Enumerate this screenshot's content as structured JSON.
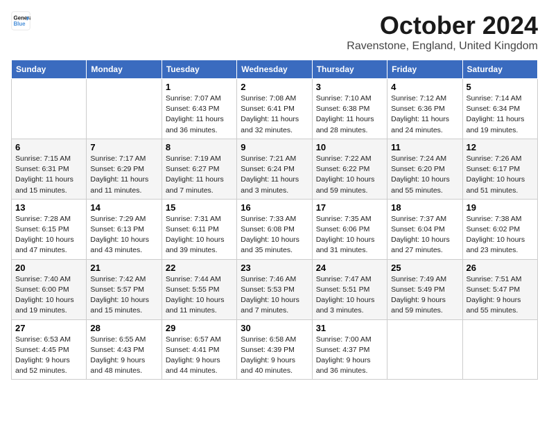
{
  "header": {
    "logo_line1": "General",
    "logo_line2": "Blue",
    "month_title": "October 2024",
    "location": "Ravenstone, England, United Kingdom"
  },
  "weekdays": [
    "Sunday",
    "Monday",
    "Tuesday",
    "Wednesday",
    "Thursday",
    "Friday",
    "Saturday"
  ],
  "weeks": [
    [
      {
        "day": "",
        "text": ""
      },
      {
        "day": "",
        "text": ""
      },
      {
        "day": "1",
        "text": "Sunrise: 7:07 AM\nSunset: 6:43 PM\nDaylight: 11 hours\nand 36 minutes."
      },
      {
        "day": "2",
        "text": "Sunrise: 7:08 AM\nSunset: 6:41 PM\nDaylight: 11 hours\nand 32 minutes."
      },
      {
        "day": "3",
        "text": "Sunrise: 7:10 AM\nSunset: 6:38 PM\nDaylight: 11 hours\nand 28 minutes."
      },
      {
        "day": "4",
        "text": "Sunrise: 7:12 AM\nSunset: 6:36 PM\nDaylight: 11 hours\nand 24 minutes."
      },
      {
        "day": "5",
        "text": "Sunrise: 7:14 AM\nSunset: 6:34 PM\nDaylight: 11 hours\nand 19 minutes."
      }
    ],
    [
      {
        "day": "6",
        "text": "Sunrise: 7:15 AM\nSunset: 6:31 PM\nDaylight: 11 hours\nand 15 minutes."
      },
      {
        "day": "7",
        "text": "Sunrise: 7:17 AM\nSunset: 6:29 PM\nDaylight: 11 hours\nand 11 minutes."
      },
      {
        "day": "8",
        "text": "Sunrise: 7:19 AM\nSunset: 6:27 PM\nDaylight: 11 hours\nand 7 minutes."
      },
      {
        "day": "9",
        "text": "Sunrise: 7:21 AM\nSunset: 6:24 PM\nDaylight: 11 hours\nand 3 minutes."
      },
      {
        "day": "10",
        "text": "Sunrise: 7:22 AM\nSunset: 6:22 PM\nDaylight: 10 hours\nand 59 minutes."
      },
      {
        "day": "11",
        "text": "Sunrise: 7:24 AM\nSunset: 6:20 PM\nDaylight: 10 hours\nand 55 minutes."
      },
      {
        "day": "12",
        "text": "Sunrise: 7:26 AM\nSunset: 6:17 PM\nDaylight: 10 hours\nand 51 minutes."
      }
    ],
    [
      {
        "day": "13",
        "text": "Sunrise: 7:28 AM\nSunset: 6:15 PM\nDaylight: 10 hours\nand 47 minutes."
      },
      {
        "day": "14",
        "text": "Sunrise: 7:29 AM\nSunset: 6:13 PM\nDaylight: 10 hours\nand 43 minutes."
      },
      {
        "day": "15",
        "text": "Sunrise: 7:31 AM\nSunset: 6:11 PM\nDaylight: 10 hours\nand 39 minutes."
      },
      {
        "day": "16",
        "text": "Sunrise: 7:33 AM\nSunset: 6:08 PM\nDaylight: 10 hours\nand 35 minutes."
      },
      {
        "day": "17",
        "text": "Sunrise: 7:35 AM\nSunset: 6:06 PM\nDaylight: 10 hours\nand 31 minutes."
      },
      {
        "day": "18",
        "text": "Sunrise: 7:37 AM\nSunset: 6:04 PM\nDaylight: 10 hours\nand 27 minutes."
      },
      {
        "day": "19",
        "text": "Sunrise: 7:38 AM\nSunset: 6:02 PM\nDaylight: 10 hours\nand 23 minutes."
      }
    ],
    [
      {
        "day": "20",
        "text": "Sunrise: 7:40 AM\nSunset: 6:00 PM\nDaylight: 10 hours\nand 19 minutes."
      },
      {
        "day": "21",
        "text": "Sunrise: 7:42 AM\nSunset: 5:57 PM\nDaylight: 10 hours\nand 15 minutes."
      },
      {
        "day": "22",
        "text": "Sunrise: 7:44 AM\nSunset: 5:55 PM\nDaylight: 10 hours\nand 11 minutes."
      },
      {
        "day": "23",
        "text": "Sunrise: 7:46 AM\nSunset: 5:53 PM\nDaylight: 10 hours\nand 7 minutes."
      },
      {
        "day": "24",
        "text": "Sunrise: 7:47 AM\nSunset: 5:51 PM\nDaylight: 10 hours\nand 3 minutes."
      },
      {
        "day": "25",
        "text": "Sunrise: 7:49 AM\nSunset: 5:49 PM\nDaylight: 9 hours\nand 59 minutes."
      },
      {
        "day": "26",
        "text": "Sunrise: 7:51 AM\nSunset: 5:47 PM\nDaylight: 9 hours\nand 55 minutes."
      }
    ],
    [
      {
        "day": "27",
        "text": "Sunrise: 6:53 AM\nSunset: 4:45 PM\nDaylight: 9 hours\nand 52 minutes."
      },
      {
        "day": "28",
        "text": "Sunrise: 6:55 AM\nSunset: 4:43 PM\nDaylight: 9 hours\nand 48 minutes."
      },
      {
        "day": "29",
        "text": "Sunrise: 6:57 AM\nSunset: 4:41 PM\nDaylight: 9 hours\nand 44 minutes."
      },
      {
        "day": "30",
        "text": "Sunrise: 6:58 AM\nSunset: 4:39 PM\nDaylight: 9 hours\nand 40 minutes."
      },
      {
        "day": "31",
        "text": "Sunrise: 7:00 AM\nSunset: 4:37 PM\nDaylight: 9 hours\nand 36 minutes."
      },
      {
        "day": "",
        "text": ""
      },
      {
        "day": "",
        "text": ""
      }
    ]
  ]
}
